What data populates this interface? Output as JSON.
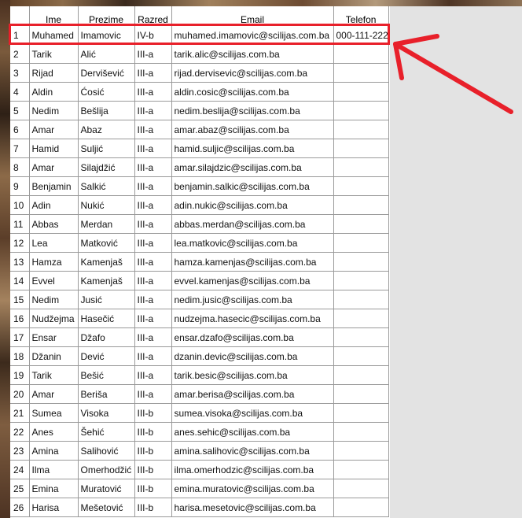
{
  "columns": [
    "",
    "Ime",
    "Prezime",
    "Razred",
    "Email",
    "Telefon"
  ],
  "rows": [
    [
      "1",
      "Muhamed",
      "Imamovic",
      "IV-b",
      "muhamed.imamovic@scilijas.com.ba",
      "000-111-222"
    ],
    [
      "2",
      "Tarik",
      "Alić",
      "III-a",
      "tarik.alic@scilijas.com.ba",
      ""
    ],
    [
      "3",
      "Rijad",
      "Dervišević",
      "III-a",
      "rijad.dervisevic@scilijas.com.ba",
      ""
    ],
    [
      "4",
      "Aldin",
      "Ćosić",
      "III-a",
      "aldin.cosic@scilijas.com.ba",
      ""
    ],
    [
      "5",
      "Nedim",
      "Bešlija",
      "III-a",
      "nedim.beslija@scilijas.com.ba",
      ""
    ],
    [
      "6",
      "Amar",
      "Abaz",
      "III-a",
      "amar.abaz@scilijas.com.ba",
      ""
    ],
    [
      "7",
      "Hamid",
      "Suljić",
      "III-a",
      "hamid.suljic@scilijas.com.ba",
      ""
    ],
    [
      "8",
      "Amar",
      "Silajdžić",
      "III-a",
      "amar.silajdzic@scilijas.com.ba",
      ""
    ],
    [
      "9",
      "Benjamin",
      "Salkić",
      "III-a",
      "benjamin.salkic@scilijas.com.ba",
      ""
    ],
    [
      "10",
      "Adin",
      "Nukić",
      "III-a",
      "adin.nukic@scilijas.com.ba",
      ""
    ],
    [
      "11",
      "Abbas",
      "Merdan",
      "III-a",
      "abbas.merdan@scilijas.com.ba",
      ""
    ],
    [
      "12",
      "Lea",
      "Matković",
      "III-a",
      "lea.matkovic@scilijas.com.ba",
      ""
    ],
    [
      "13",
      "Hamza",
      "Kamenjaš",
      "III-a",
      "hamza.kamenjas@scilijas.com.ba",
      ""
    ],
    [
      "14",
      "Evvel",
      "Kamenjaš",
      "III-a",
      "evvel.kamenjas@scilijas.com.ba",
      ""
    ],
    [
      "15",
      "Nedim",
      "Jusić",
      "III-a",
      "nedim.jusic@scilijas.com.ba",
      ""
    ],
    [
      "16",
      "Nudžejma",
      "Hasečić",
      "III-a",
      "nudzejma.hasecic@scilijas.com.ba",
      ""
    ],
    [
      "17",
      "Ensar",
      "Džafo",
      "III-a",
      "ensar.dzafo@scilijas.com.ba",
      ""
    ],
    [
      "18",
      "Džanin",
      "Dević",
      "III-a",
      "dzanin.devic@scilijas.com.ba",
      ""
    ],
    [
      "19",
      "Tarik",
      "Bešić",
      "III-a",
      "tarik.besic@scilijas.com.ba",
      ""
    ],
    [
      "20",
      "Amar",
      "Beriša",
      "III-a",
      "amar.berisa@scilijas.com.ba",
      ""
    ],
    [
      "21",
      "Sumea",
      "Visoka",
      "III-b",
      "sumea.visoka@scilijas.com.ba",
      ""
    ],
    [
      "22",
      "Anes",
      "Šehić",
      "III-b",
      "anes.sehic@scilijas.com.ba",
      ""
    ],
    [
      "23",
      "Amina",
      "Salihović",
      "III-b",
      "amina.salihovic@scilijas.com.ba",
      ""
    ],
    [
      "24",
      "Ilma",
      "Omerhodžić",
      "III-b",
      "ilma.omerhodzic@scilijas.com.ba",
      ""
    ],
    [
      "25",
      "Emina",
      "Muratović",
      "III-b",
      "emina.muratovic@scilijas.com.ba",
      ""
    ],
    [
      "26",
      "Harisa",
      "Mešetović",
      "III-b",
      "harisa.mesetovic@scilijas.com.ba",
      ""
    ]
  ],
  "colors": {
    "annotation": "#e8202a",
    "grid": "#9a9a9a",
    "background": "#e3e3e3"
  }
}
